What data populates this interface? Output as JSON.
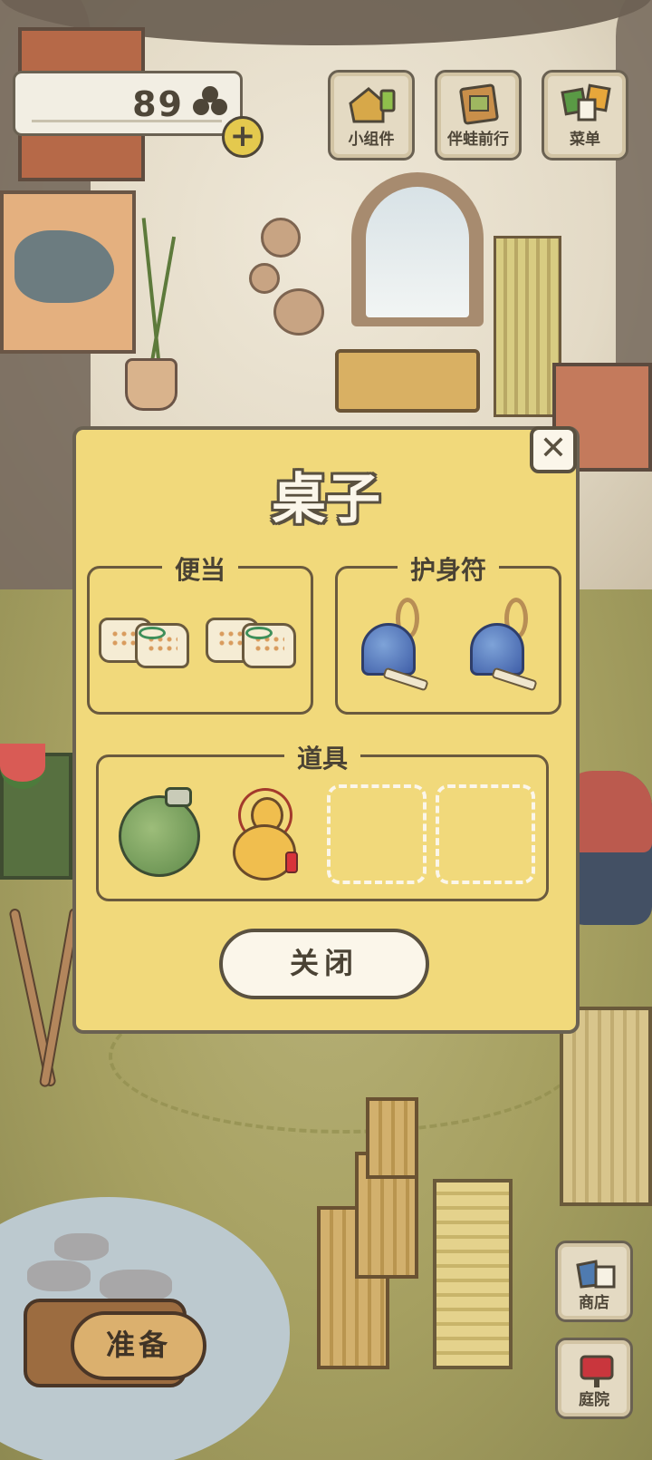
{
  "hud": {
    "clover_count": "89",
    "plus_label": "+"
  },
  "top_buttons": [
    {
      "label": "小组件",
      "icon": "house-widget-icon"
    },
    {
      "label": "伴蛙前行",
      "icon": "album-icon"
    },
    {
      "label": "菜单",
      "icon": "menu-cards-icon"
    }
  ],
  "modal": {
    "title": "桌子",
    "sections": {
      "bento": {
        "label": "便当",
        "items": [
          "bento-icon",
          "bento-icon"
        ]
      },
      "charm": {
        "label": "护身符",
        "items": [
          "bell-charm-icon",
          "bell-charm-icon"
        ]
      },
      "tools": {
        "label": "道具",
        "items": [
          "canteen-icon",
          "gourd-icon",
          "empty",
          "empty"
        ]
      }
    },
    "close_button": "关闭",
    "close_x": "✕"
  },
  "bottom": {
    "prepare_label": "准备",
    "shop_label": "商店",
    "yard_label": "庭院"
  },
  "colors": {
    "modal_bg": "#f1d97b",
    "outline": "#5a5140",
    "button_bg": "#fbf6ea",
    "plus_button": "#e4c94e"
  }
}
